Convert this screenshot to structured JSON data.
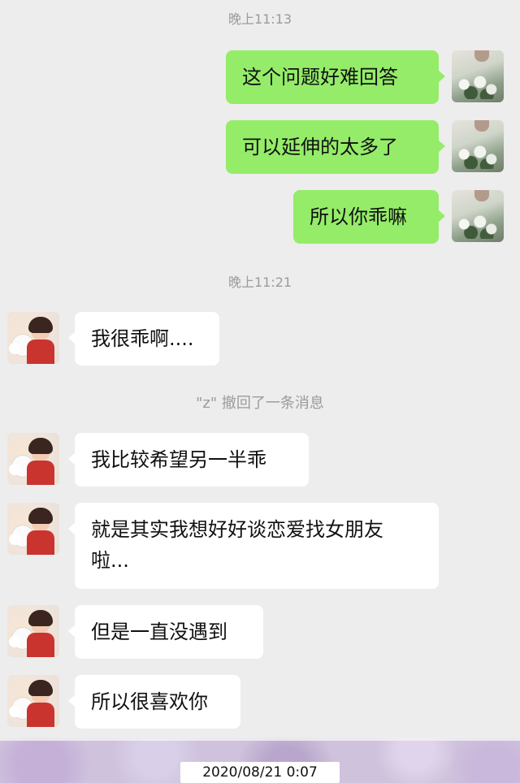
{
  "chat": {
    "time1": "晚上11:13",
    "outgoing": [
      {
        "text": "这个问题好难回答"
      },
      {
        "text": "可以延伸的太多了"
      },
      {
        "text": "所以你乖嘛"
      }
    ],
    "time2": "晚上11:21",
    "incoming1": "我很乖啊....",
    "recall_notice": "\"z\" 撤回了一条消息",
    "incoming": [
      {
        "text": "我比较希望另一半乖"
      },
      {
        "line1": "就是其实我想好好谈恋爱找女朋友",
        "line2": "啦..."
      },
      {
        "text": "但是一直没遇到"
      },
      {
        "text": "所以很喜欢你"
      }
    ]
  },
  "footer": {
    "timestamp": "2020/08/21 0:07"
  },
  "colors": {
    "background": "#ededed",
    "outgoing_bubble": "#95ec69",
    "incoming_bubble": "#ffffff",
    "system_text": "#9b9b9b"
  },
  "icons": {
    "my_avatar": "avatar-flowers-photo",
    "their_avatar": "avatar-cartoon-boy-with-dog"
  }
}
